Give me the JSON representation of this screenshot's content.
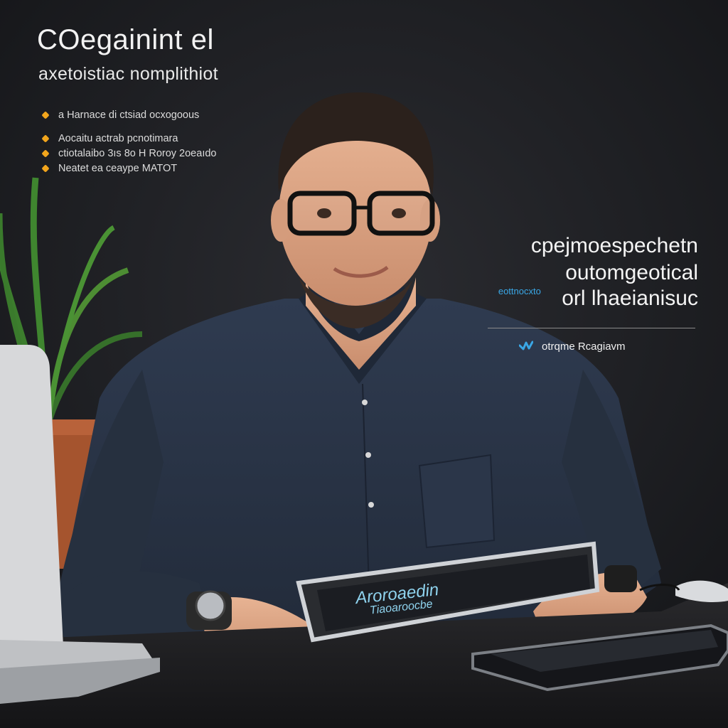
{
  "poster": {
    "title": "COegainint el",
    "subtitle": "axetoistiac nomplithiot",
    "bullets": [
      "a Harnace di ctsiad ocxogoous",
      "Aocaitu actrab pcnotimara",
      "ctiotalaibo 3ıs 8o H Roroy 2oeaıdo",
      "Neatet ea ceaype MATOT"
    ],
    "right_text": {
      "line1": "cpejmoespechetn",
      "line2": "outomgeotical",
      "tag": "eottnocxto",
      "line3": "orl lhaeianisuc"
    },
    "credit": {
      "icon": "wave-check-icon",
      "label": "otrqme Rcagiavm"
    },
    "tablet_label": {
      "line1": "Aroroaedin",
      "line2": "Tiaoaroocbe"
    }
  },
  "colors": {
    "background": "#1a1b1f",
    "shirt": "#2a3548",
    "accent": "#f2a51c",
    "link": "#3aa7e6"
  }
}
